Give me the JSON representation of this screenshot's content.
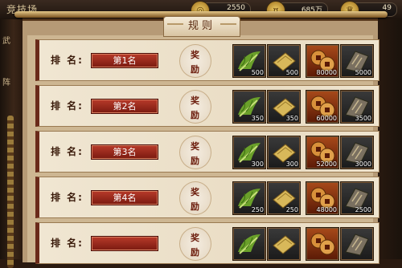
{
  "header": {
    "arena_title": "竞技场",
    "resources": [
      {
        "icon": "silver-coin-icon",
        "value": "2550"
      },
      {
        "icon": "gold-coin-icon",
        "value": "685万"
      },
      {
        "icon": "ingot-icon",
        "value": "49"
      }
    ]
  },
  "sidebar": {
    "labels": [
      "武",
      "阵"
    ]
  },
  "panel": {
    "tab_title": "规则"
  },
  "rank_label": "排  名:",
  "reward_label_1": "奖",
  "reward_label_2": "励",
  "rows": [
    {
      "rank": "第1名",
      "items": [
        "500",
        "500",
        "80000",
        "5000"
      ]
    },
    {
      "rank": "第2名",
      "items": [
        "350",
        "350",
        "60000",
        "3500"
      ]
    },
    {
      "rank": "第3名",
      "items": [
        "300",
        "300",
        "52000",
        "3000"
      ]
    },
    {
      "rank": "第4名",
      "items": [
        "250",
        "250",
        "48000",
        "2500"
      ]
    },
    {
      "rank": "",
      "items": [
        "",
        "",
        "",
        ""
      ]
    }
  ],
  "item_icons": [
    "herb-bundle-icon",
    "gold-scroll-icon",
    "copper-coin-icon",
    "stone-tablet-icon"
  ]
}
